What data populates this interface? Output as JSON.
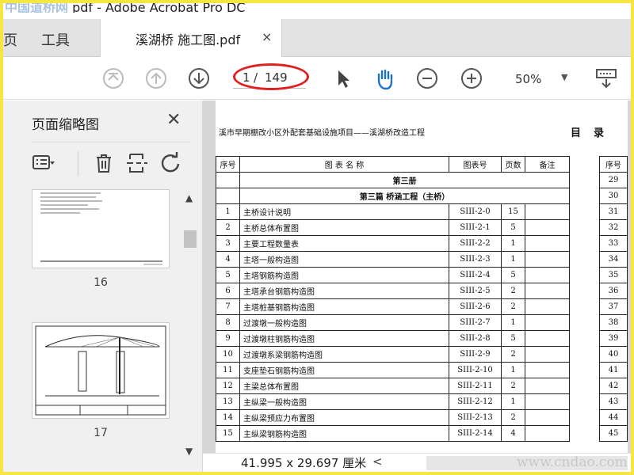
{
  "window": {
    "title_watermark": "中国道桥网",
    "title_text": "pdf - Adobe Acrobat Pro DC"
  },
  "tabs": {
    "home_partial": "页",
    "tools": "工具",
    "active_tab_title": "溪湖桥 施工图.pdf",
    "close_glyph": "×"
  },
  "toolbar": {
    "page_current": "1",
    "page_separator": "/",
    "page_total": "149",
    "zoom": "50%",
    "zoom_dropdown_glyph": "▼"
  },
  "left_panel": {
    "title": "页面缩略图",
    "close_glyph": "✕",
    "thumbnails": [
      {
        "label": "16"
      },
      {
        "label": "17"
      }
    ]
  },
  "document": {
    "heading": "溪市早期棚改小区外配套基础设施项目——溪湖桥改造工程",
    "mulu": "目录",
    "headers": {
      "no": "序号",
      "name": "图 表 名 称",
      "code": "图表号",
      "pages": "页数",
      "remark": "备注"
    },
    "volume": "第三册",
    "chapter": "第三篇 桥涵工程（主桥）",
    "rows": [
      {
        "no": "1",
        "name": "主桥设计说明",
        "code": "SIII-2-0",
        "pages": "15"
      },
      {
        "no": "2",
        "name": "主桥总体布置图",
        "code": "SIII-2-1",
        "pages": "5"
      },
      {
        "no": "3",
        "name": "主要工程数量表",
        "code": "SIII-2-2",
        "pages": "1"
      },
      {
        "no": "4",
        "name": "主塔一般构造图",
        "code": "SIII-2-3",
        "pages": "1"
      },
      {
        "no": "5",
        "name": "主塔钢筋构造图",
        "code": "SIII-2-4",
        "pages": "5"
      },
      {
        "no": "6",
        "name": "主塔承台钢筋构造图",
        "code": "SIII-2-5",
        "pages": "2"
      },
      {
        "no": "7",
        "name": "主塔桩基钢筋构造图",
        "code": "SIII-2-6",
        "pages": "2"
      },
      {
        "no": "8",
        "name": "过渡墩一般构造图",
        "code": "SIII-2-7",
        "pages": "1"
      },
      {
        "no": "9",
        "name": "过渡墩柱钢筋构造图",
        "code": "SIII-2-8",
        "pages": "5"
      },
      {
        "no": "10",
        "name": "过渡墩系梁钢筋构造图",
        "code": "SIII-2-9",
        "pages": "2"
      },
      {
        "no": "11",
        "name": "支座垫石钢筋构造图",
        "code": "SIII-2-10",
        "pages": "1"
      },
      {
        "no": "12",
        "name": "主梁总体布置图",
        "code": "SIII-2-11",
        "pages": "2"
      },
      {
        "no": "13",
        "name": "主纵梁一般构造图",
        "code": "SIII-2-12",
        "pages": "1"
      },
      {
        "no": "14",
        "name": "主纵梁预应力布置图",
        "code": "SIII-2-13",
        "pages": "2"
      },
      {
        "no": "15",
        "name": "主纵梁钢筋构造图",
        "code": "SIII-2-14",
        "pages": "4"
      }
    ],
    "right_column": {
      "header": "序号",
      "numbers": [
        "29",
        "30",
        "31",
        "32",
        "33",
        "34",
        "35",
        "36",
        "37",
        "38",
        "39",
        "40",
        "41",
        "42",
        "43",
        "44",
        "45"
      ]
    }
  },
  "statusbar": {
    "dimensions": "41.995 x 29.697 厘米",
    "scroll_left_glyph": "<"
  },
  "watermark": "www.cndao.com"
}
